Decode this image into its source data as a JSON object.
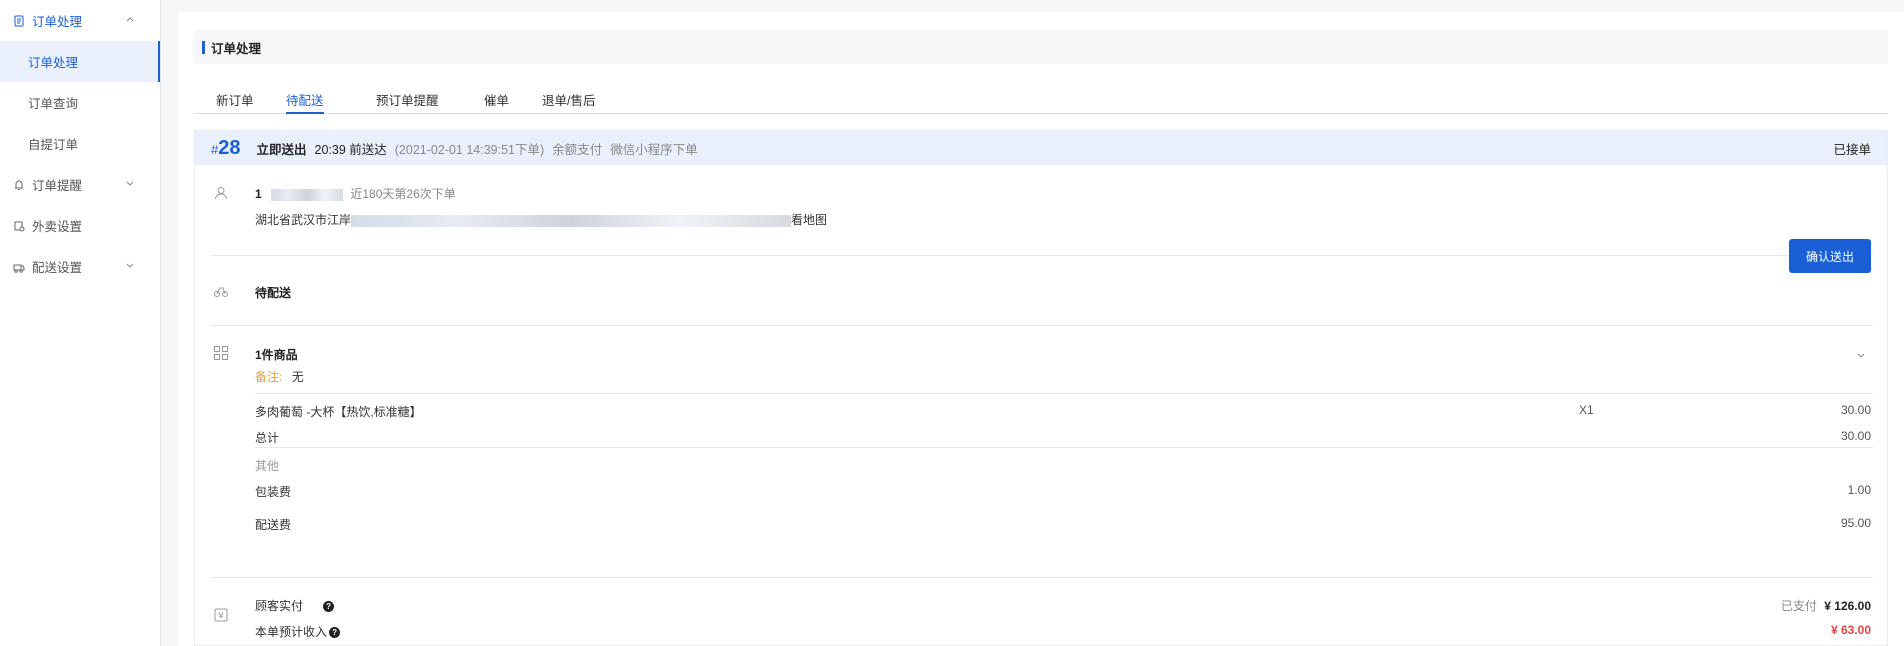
{
  "sidebar": {
    "groups": [
      {
        "label": "订单处理",
        "icon": "document-icon"
      },
      {
        "label": "订单提醒",
        "icon": "bell-icon"
      },
      {
        "label": "外卖设置",
        "icon": "shop-settings-icon"
      },
      {
        "label": "配送设置",
        "icon": "delivery-icon"
      }
    ],
    "items": [
      "订单处理",
      "订单查询",
      "自提订单"
    ]
  },
  "header": {
    "title": "订单处理"
  },
  "tabs": [
    "新订单",
    "待配送",
    "预订单提醒",
    "催单",
    "退单/售后"
  ],
  "order": {
    "hash": "#",
    "number": "28",
    "delivery_mode": "立即送出",
    "deliver_by": "20:39 前送达",
    "placed_at": "(2021-02-01 14:39:51下单)",
    "payment": "余额支付",
    "channel": "微信小程序下单",
    "status": "已接单",
    "customer": {
      "name_prefix": "1",
      "order_history": "近180天第26次下单",
      "address_prefix": "湖北省武汉市江岸",
      "map_link": "看地图"
    },
    "delivery": {
      "status": "待配送",
      "confirm_button": "确认送出"
    },
    "goods": {
      "summary": "1件商品",
      "note_label": "备注:",
      "note_value": "无",
      "items": [
        {
          "name": "多肉葡萄 -大杯【热饮,标准糖】",
          "qty": "X1",
          "price": "30.00"
        }
      ],
      "subtotal_label": "总计",
      "subtotal": "30.00",
      "other_label": "其他",
      "packaging_label": "包装费",
      "packaging": "1.00",
      "delivery_fee_label": "配送费",
      "delivery_fee": "95.00"
    },
    "payment_summary": {
      "paid_label": "顾客实付",
      "paid_status": "已支付",
      "paid_amount": "¥ 126.00",
      "income_label": "本单预计收入",
      "income_amount": "¥ 63.00"
    }
  }
}
